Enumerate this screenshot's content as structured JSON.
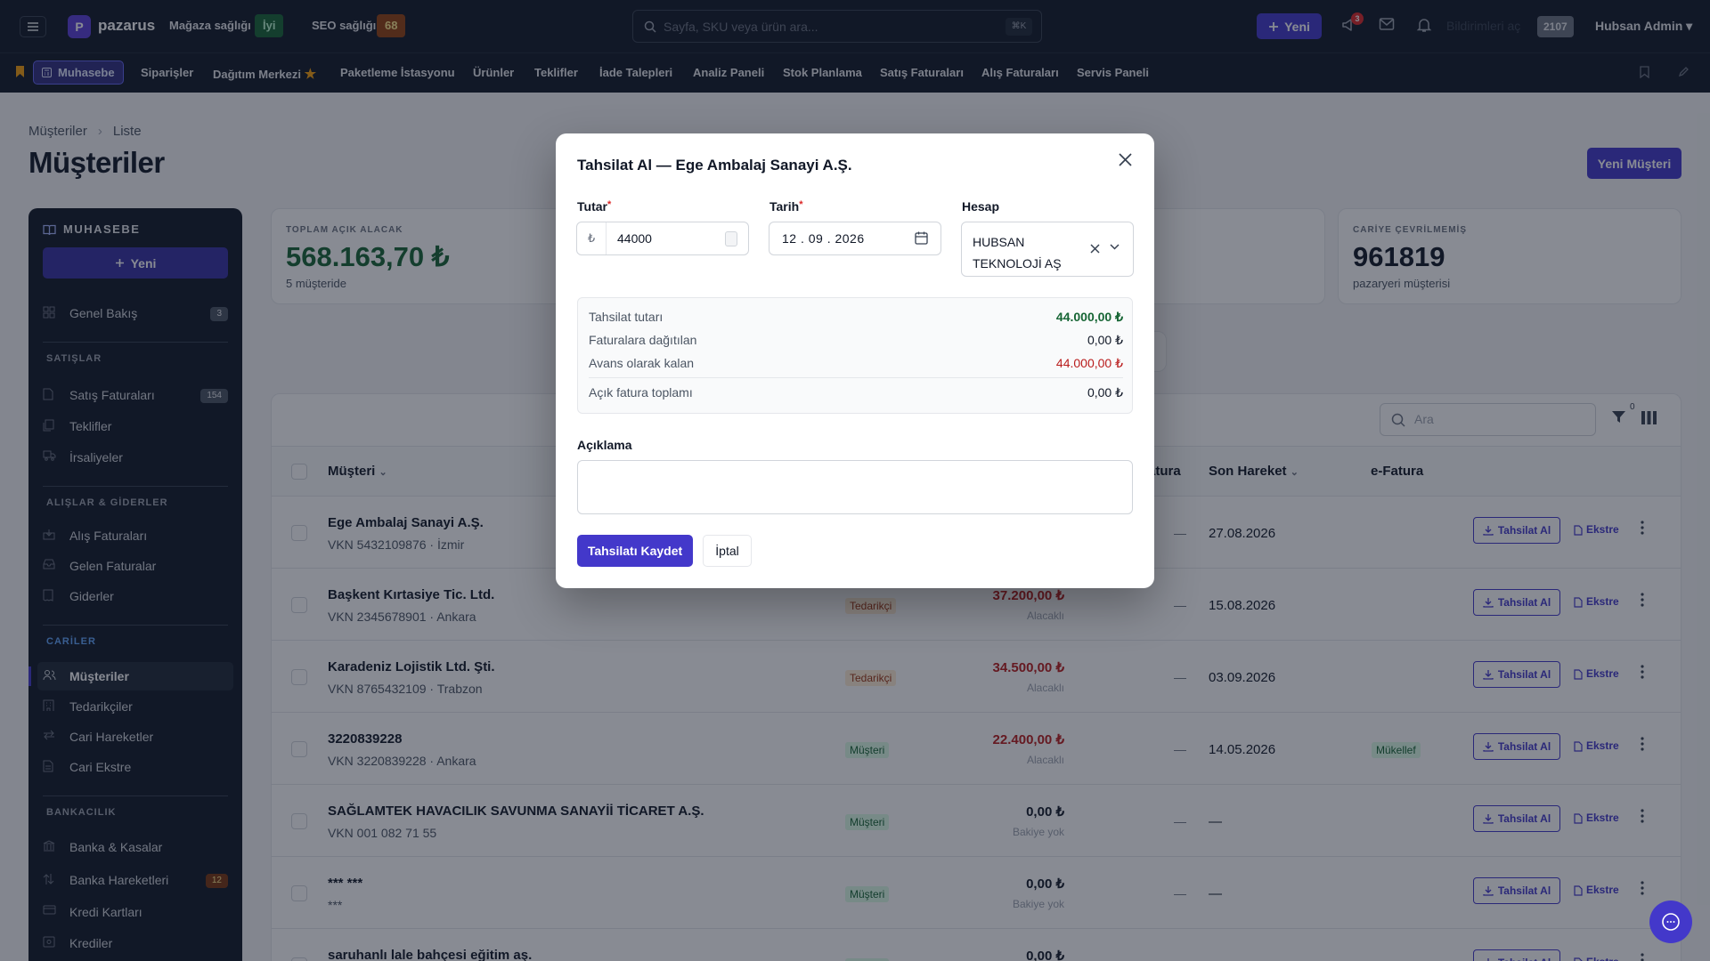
{
  "topbar": {
    "logo_letter": "P",
    "brand": "pazarus",
    "store_health_label": "Mağaza sağlığı",
    "store_health_value": "İyi",
    "seo_health_label": "SEO sağlığı",
    "seo_health_value": "68",
    "search_placeholder": "Sayfa, SKU veya ürün ara...",
    "search_shortcut": "⌘K",
    "new_button": "Yeni",
    "notification_count": "3",
    "notifications_text": "Bildirimleri aç",
    "notifications_number": "2107",
    "user": "Hubsan Admin",
    "user_caret": "▾"
  },
  "nav": {
    "active": "Muhasebe",
    "items": [
      "Siparişler",
      "Dağıtım Merkezi",
      "Paketleme İstasyonu",
      "Ürünler",
      "Teklifler",
      "İade Talepleri",
      "Analiz Paneli",
      "Stok Planlama",
      "Satış Faturaları",
      "Alış Faturaları",
      "Servis Paneli"
    ],
    "star": "★"
  },
  "page": {
    "breadcrumb": [
      "Müşteriler",
      "Liste"
    ],
    "breadcrumb_sep": "›",
    "title": "Müşteriler",
    "new_customer_button": "Yeni Müşteri"
  },
  "sidebar": {
    "header": "MUHASEBE",
    "new_button": "Yeni",
    "overview": {
      "label": "Genel Bakış",
      "count": "3"
    },
    "sections": [
      {
        "title": "SATIŞLAR",
        "items": [
          {
            "label": "Satış Faturaları",
            "count": "154"
          },
          {
            "label": "Teklifler"
          },
          {
            "label": "İrsaliyeler"
          }
        ]
      },
      {
        "title": "ALIŞLAR & GİDERLER",
        "items": [
          {
            "label": "Alış Faturaları"
          },
          {
            "label": "Gelen Faturalar"
          },
          {
            "label": "Giderler"
          }
        ]
      },
      {
        "title": "CARİLER",
        "items": [
          {
            "label": "Müşteriler"
          },
          {
            "label": "Tedarikçiler"
          },
          {
            "label": "Cari Hareketler"
          },
          {
            "label": "Cari Ekstre"
          }
        ]
      },
      {
        "title": "BANKACILIK",
        "items": [
          {
            "label": "Banka & Kasalar"
          },
          {
            "label": "Banka Hareketleri",
            "count": "12"
          },
          {
            "label": "Kredi Kartları"
          },
          {
            "label": "Krediler"
          }
        ]
      }
    ]
  },
  "cards": [
    {
      "label": "TOPLAM AÇIK ALACAK",
      "value": "568.163,70 ₺",
      "sub": "5 müşteride"
    },
    {
      "label": "CARİYE ÇEVRİLMEMİŞ",
      "value": "961819",
      "sub": "pazaryeri müşterisi"
    }
  ],
  "table": {
    "search_placeholder": "Ara",
    "filter_count": "0",
    "columns": [
      "Müşteri",
      "atura",
      "Son Hareket",
      "e-Fatura"
    ],
    "action_collect": "Tahsilat Al",
    "action_statement": "Ekstre",
    "rows": [
      {
        "name": "Ege Ambalaj Sanayi A.Ş.",
        "sub": "VKN 5432109876 · İzmir",
        "type": "",
        "amount": "",
        "amount_label": "",
        "dash": "—",
        "date": "27.08.2026",
        "efatura": ""
      },
      {
        "name": "Başkent Kırtasiye Tic. Ltd.",
        "sub": "VKN 2345678901 · Ankara",
        "type": "Tedarikçi",
        "amount": "37.200,00 ₺",
        "amount_label": "Alacaklı",
        "dash": "—",
        "date": "15.08.2026",
        "efatura": ""
      },
      {
        "name": "Karadeniz Lojistik Ltd. Şti.",
        "sub": "VKN 8765432109 · Trabzon",
        "type": "Tedarikçi",
        "amount": "34.500,00 ₺",
        "amount_label": "Alacaklı",
        "dash": "—",
        "date": "03.09.2026",
        "efatura": ""
      },
      {
        "name": "3220839228",
        "sub": "VKN 3220839228 · Ankara",
        "type": "Müşteri",
        "amount": "22.400,00 ₺",
        "amount_label": "Alacaklı",
        "dash": "—",
        "date": "14.05.2026",
        "efatura": "Mükellef"
      },
      {
        "name": "SAĞLAMTEK HAVACILIK SAVUNMA SANAYİİ TİCARET A.Ş.",
        "sub": "VKN 001 082 71 55",
        "type": "Müşteri",
        "amount": "0,00 ₺",
        "amount_label": "Bakiye yok",
        "dash": "—",
        "date": "—",
        "efatura": ""
      },
      {
        "name": "*** ***",
        "sub": "***",
        "type": "Müşteri",
        "amount": "0,00 ₺",
        "amount_label": "Bakiye yok",
        "dash": "—",
        "date": "—",
        "efatura": ""
      },
      {
        "name": "saruhanlı lale bahçesi eğitim aş.",
        "sub": "",
        "type": "Müşteri",
        "amount": "0,00 ₺",
        "amount_label": "",
        "dash": "",
        "date": "",
        "efatura": ""
      }
    ]
  },
  "modal": {
    "title": "Tahsilat Al — Ege Ambalaj Sanayi A.Ş.",
    "amount_label": "Tutar",
    "required_mark": "*",
    "currency_symbol": "₺",
    "amount_value": "44000",
    "date_label": "Tarih",
    "date_value": "12 . 09 . 2026",
    "account_label": "Hesap",
    "account_value": "HUBSAN TEKNOLOJİ AŞ",
    "summary": [
      {
        "key": "Tahsilat tutarı",
        "value": "44.000,00 ₺"
      },
      {
        "key": "Faturalara dağıtılan",
        "value": "0,00 ₺"
      },
      {
        "key": "Avans olarak kalan",
        "value": "44.000,00 ₺"
      },
      {
        "key": "Açık fatura toplamı",
        "value": "0,00 ₺"
      }
    ],
    "description_label": "Açıklama",
    "save_button": "Tahsilatı Kaydet",
    "cancel_button": "İptal"
  },
  "colors": {
    "accent": "#4338ca",
    "positive": "#166534",
    "negative": "#b91c1c",
    "topbar_bg": "#111827"
  }
}
